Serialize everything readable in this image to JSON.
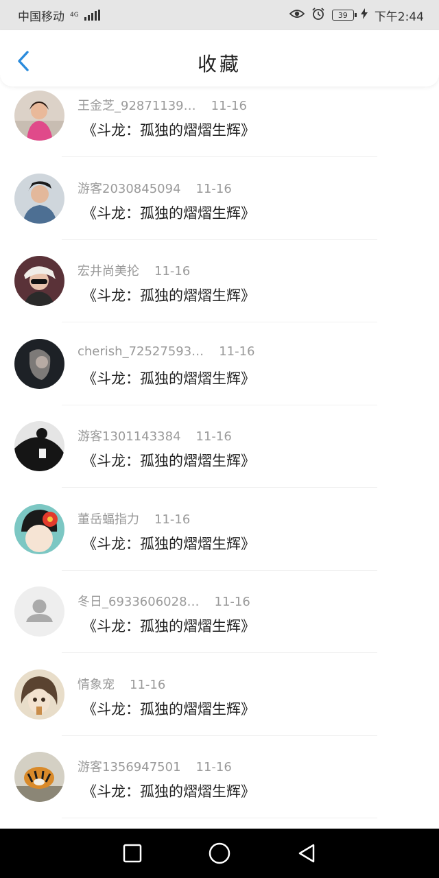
{
  "status_bar": {
    "carrier": "中国移动",
    "network_type": "4G",
    "battery_level": "39",
    "time": "下午2:44"
  },
  "header": {
    "title": "收藏",
    "back_icon": "chevron-left-icon",
    "accent_color": "#2a8bdc"
  },
  "favorites": [
    {
      "user": "王金芝_92871139…",
      "date": "11-16",
      "title": "《斗龙：孤独的熠熠生辉》",
      "avatar": "photo-girl-pink"
    },
    {
      "user": "游客2030845094",
      "date": "11-16",
      "title": "《斗龙：孤独的熠熠生辉》",
      "avatar": "photo-boy-denim"
    },
    {
      "user": "宏井尚美抡",
      "date": "11-16",
      "title": "《斗龙：孤独的熠熠生辉》",
      "avatar": "photo-sunglasses"
    },
    {
      "user": "cherish_72527593…",
      "date": "11-16",
      "title": "《斗龙：孤独的熠熠生辉》",
      "avatar": "photo-dark-portrait"
    },
    {
      "user": "游客1301143384",
      "date": "11-16",
      "title": "《斗龙：孤独的熠熠生辉》",
      "avatar": "photo-black-white"
    },
    {
      "user": "董岳蝠指力",
      "date": "11-16",
      "title": "《斗龙：孤独的熠熠生辉》",
      "avatar": "illustration-flower"
    },
    {
      "user": "冬日_6933606028…",
      "date": "11-16",
      "title": "《斗龙：孤独的熠熠生辉》",
      "avatar": "default-user-icon"
    },
    {
      "user": "情象宠",
      "date": "11-16",
      "title": "《斗龙：孤独的熠熠生辉》",
      "avatar": "illustration-anime"
    },
    {
      "user": "游客1356947501",
      "date": "11-16",
      "title": "《斗龙：孤独的熠熠生辉》",
      "avatar": "photo-tiger"
    }
  ],
  "nav_bar": {
    "recents_icon": "square-icon",
    "home_icon": "circle-icon",
    "back_icon": "triangle-back-icon"
  }
}
